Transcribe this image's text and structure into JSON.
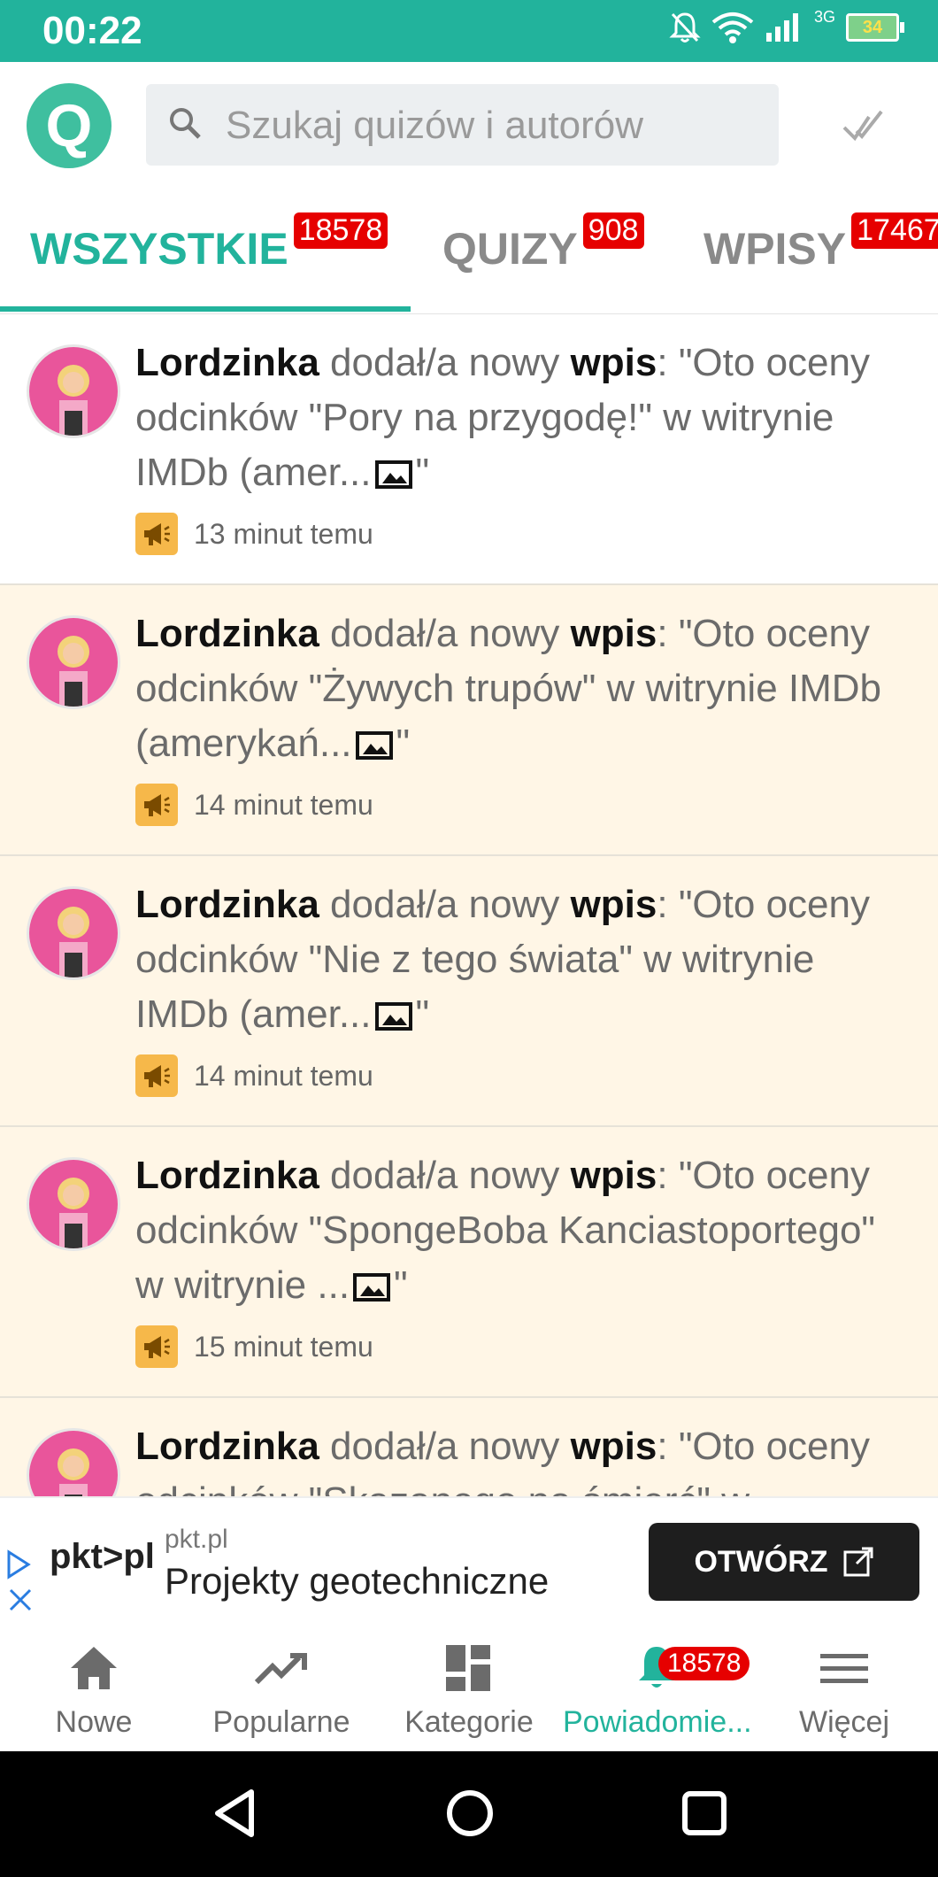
{
  "status_bar": {
    "time": "00:22",
    "network": "3G",
    "battery": "34"
  },
  "search": {
    "placeholder": "Szukaj quizów i autorów"
  },
  "tabs": [
    {
      "label": "WSZYSTKIE",
      "count": "18578",
      "active": true
    },
    {
      "label": "QUIZY",
      "count": "908",
      "active": false
    },
    {
      "label": "WPISY",
      "count": "17467",
      "active": false
    }
  ],
  "feed": {
    "items": [
      {
        "author": "Lordzinka",
        "action": "dodał/a nowy",
        "type": "wpis",
        "snippet": "\"Oto oceny odcinków \"Pory na przygodę!\" w witrynie IMDb (amer...",
        "time": "13 minut temu",
        "unread": false
      },
      {
        "author": "Lordzinka",
        "action": "dodał/a nowy",
        "type": "wpis",
        "snippet": "\"Oto oceny odcinków \"Żywych trupów\" w witrynie IMDb (amerykań...",
        "time": "14 minut temu",
        "unread": true
      },
      {
        "author": "Lordzinka",
        "action": "dodał/a nowy",
        "type": "wpis",
        "snippet": "\"Oto oceny odcinków \"Nie z tego świata\" w witrynie IMDb (amer...",
        "time": "14 minut temu",
        "unread": true
      },
      {
        "author": "Lordzinka",
        "action": "dodał/a nowy",
        "type": "wpis",
        "snippet": "\"Oto oceny odcinków \"SpongeBoba Kanciastoportego\" w witrynie ...",
        "time": "15 minut temu",
        "unread": true
      },
      {
        "author": "Lordzinka",
        "action": "dodał/a nowy",
        "type": "wpis",
        "snippet": "\"Oto oceny odcinków \"Skazanego na śmierć\" w",
        "time": "",
        "unread": true
      }
    ]
  },
  "ad": {
    "logo": "pkt>pl",
    "domain": "pkt.pl",
    "title": "Projekty geotechniczne",
    "button": "OTWÓRZ"
  },
  "bottom_nav": [
    {
      "label": "Nowe",
      "icon": "home-icon"
    },
    {
      "label": "Popularne",
      "icon": "trending-icon"
    },
    {
      "label": "Kategorie",
      "icon": "grid-icon"
    },
    {
      "label": "Powiadomie...",
      "icon": "bell-icon",
      "badge": "18578",
      "active": true
    },
    {
      "label": "Więcej",
      "icon": "menu-icon"
    }
  ],
  "colors": {
    "accent": "#22b39c",
    "badge": "#e60000",
    "unread_bg": "#fff6e6",
    "megaphone": "#f6b84a"
  }
}
